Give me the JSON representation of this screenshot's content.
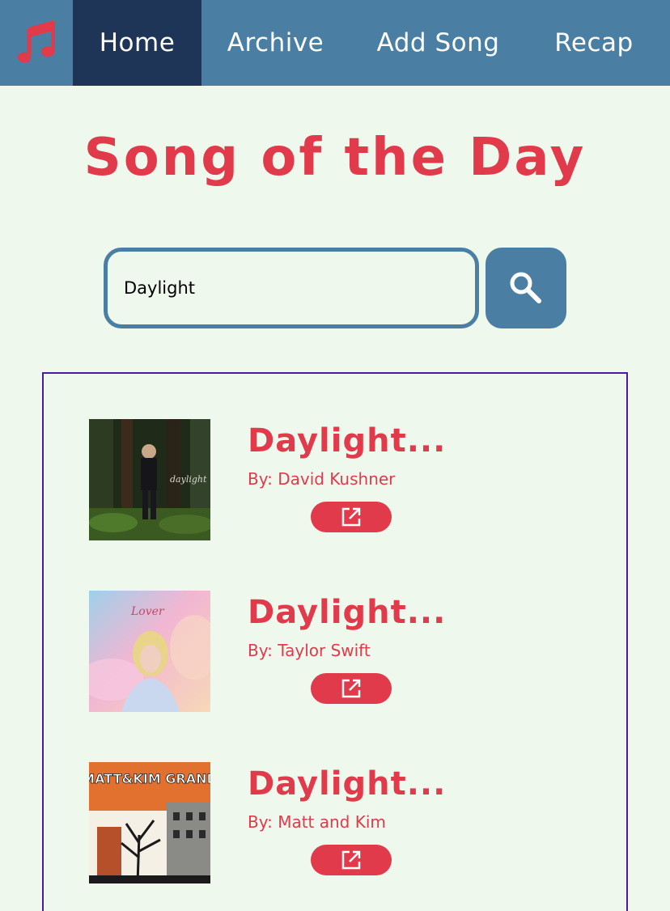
{
  "nav": {
    "logo_icon": "music-note-icon",
    "items": [
      {
        "label": "Home",
        "active": true
      },
      {
        "label": "Archive",
        "active": false
      },
      {
        "label": "Add Song",
        "active": false
      },
      {
        "label": "Recap",
        "active": false
      }
    ]
  },
  "page": {
    "title": "Song of the Day"
  },
  "search": {
    "value": "Daylight",
    "button_icon": "search-icon"
  },
  "results": [
    {
      "title": "Daylight...",
      "artist": "By: David Kushner",
      "cover_text": "daylight",
      "open_icon": "external-link-icon"
    },
    {
      "title": "Daylight...",
      "artist": "By: Taylor Swift",
      "cover_text": "Lover",
      "open_icon": "external-link-icon"
    },
    {
      "title": "Daylight...",
      "artist": "By: Matt and Kim",
      "cover_text": "MATT&KIM GRAND",
      "open_icon": "external-link-icon"
    }
  ],
  "colors": {
    "nav": "#4a7fa3",
    "nav_active": "#1e3558",
    "accent": "#e03a4b",
    "background": "#eff8ed",
    "results_border": "#4b1a9e"
  }
}
